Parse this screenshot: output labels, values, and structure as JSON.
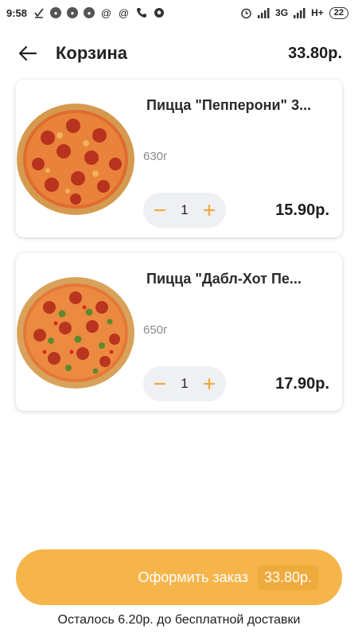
{
  "status_bar": {
    "time": "9:58",
    "network": "3G",
    "network2": "H+",
    "battery": "22",
    "icons": [
      "check-icon",
      "notification-dot-icon",
      "notification-dot-icon",
      "notification-dot-icon",
      "at-icon",
      "at-icon",
      "call-icon",
      "soccer-ball-icon",
      "alarm-icon",
      "signal-icon",
      "signal-icon"
    ]
  },
  "header": {
    "title": "Корзина",
    "total": "33.80р."
  },
  "cart": {
    "items": [
      {
        "name": "Пицца \"Пепперони\" 3...",
        "weight": "630г",
        "quantity": "1",
        "price": "15.90р."
      },
      {
        "name": "Пицца \"Дабл-Хот Пе...",
        "weight": "650г",
        "quantity": "1",
        "price": "17.90р."
      }
    ]
  },
  "checkout": {
    "label": "Оформить заказ",
    "price": "33.80р."
  },
  "delivery_note": "Осталось 6.20р. до бесплатной доставки",
  "colors": {
    "accent": "#f6b54a",
    "stepper_icon": "#f3a93c",
    "stepper_bg": "#eef0f3"
  }
}
